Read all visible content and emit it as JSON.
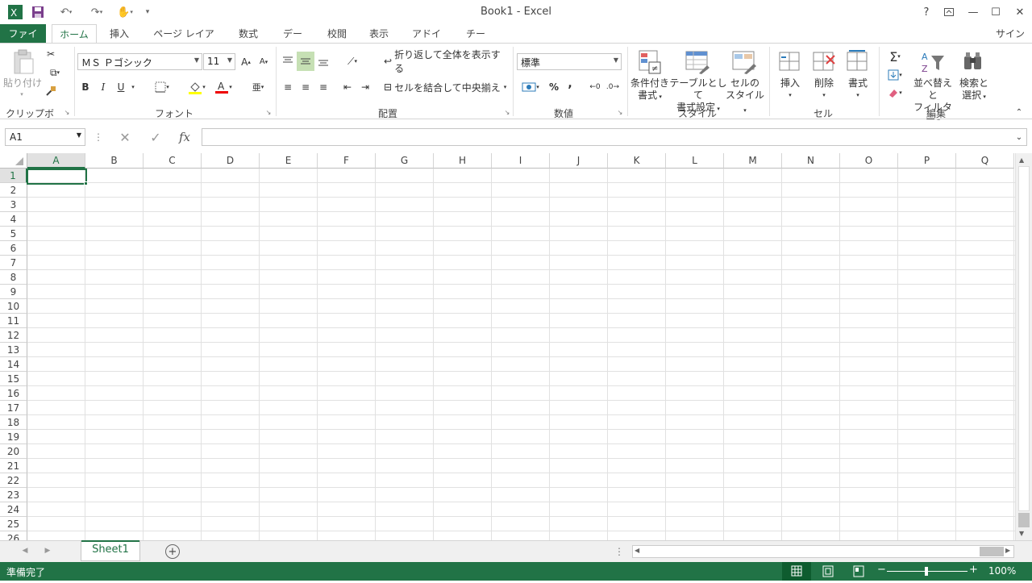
{
  "title": "Book1 - Excel",
  "tabs": [
    "ファイル",
    "ホーム",
    "挿入",
    "ページ レイアウト",
    "数式",
    "データ",
    "校閲",
    "表示",
    "アドイン",
    "チーム"
  ],
  "signin": "サインイン",
  "clipboard": {
    "paste": "貼り付け",
    "group": "クリップボード"
  },
  "font": {
    "name": "ＭＳ Ｐゴシック",
    "size": "11",
    "group": "フォント",
    "bold": "B",
    "italic": "I",
    "underline": "U"
  },
  "alignment": {
    "wrap": "折り返して全体を表示する",
    "merge": "セルを結合して中央揃え",
    "group": "配置"
  },
  "number": {
    "format": "標準",
    "group": "数値",
    "percent": "%",
    "comma": ","
  },
  "styles": {
    "cond_format_1": "条件付き",
    "cond_format_2": "書式",
    "table_1": "テーブルとして",
    "table_2": "書式設定",
    "cell_1": "セルの",
    "cell_2": "スタイル",
    "group": "スタイル"
  },
  "cells": {
    "insert": "挿入",
    "delete": "削除",
    "format": "書式",
    "group": "セル"
  },
  "editing": {
    "sort_1": "並べ替えと",
    "sort_2": "フィルター",
    "find_1": "検索と",
    "find_2": "選択",
    "group": "編集"
  },
  "namebox": "A1",
  "fx": "fx",
  "columns": [
    "A",
    "B",
    "C",
    "D",
    "E",
    "F",
    "G",
    "H",
    "I",
    "J",
    "K",
    "L",
    "M",
    "N",
    "O",
    "P",
    "Q"
  ],
  "rows": [
    "1",
    "2",
    "3",
    "4",
    "5",
    "6",
    "7",
    "8",
    "9",
    "10",
    "11",
    "12",
    "13",
    "14",
    "15",
    "16",
    "17",
    "18",
    "19",
    "20",
    "21",
    "22",
    "23",
    "24",
    "25",
    "26"
  ],
  "sheet": "Sheet1",
  "status": "準備完了",
  "zoom": "100%",
  "colors": {
    "accent": "#217346"
  }
}
